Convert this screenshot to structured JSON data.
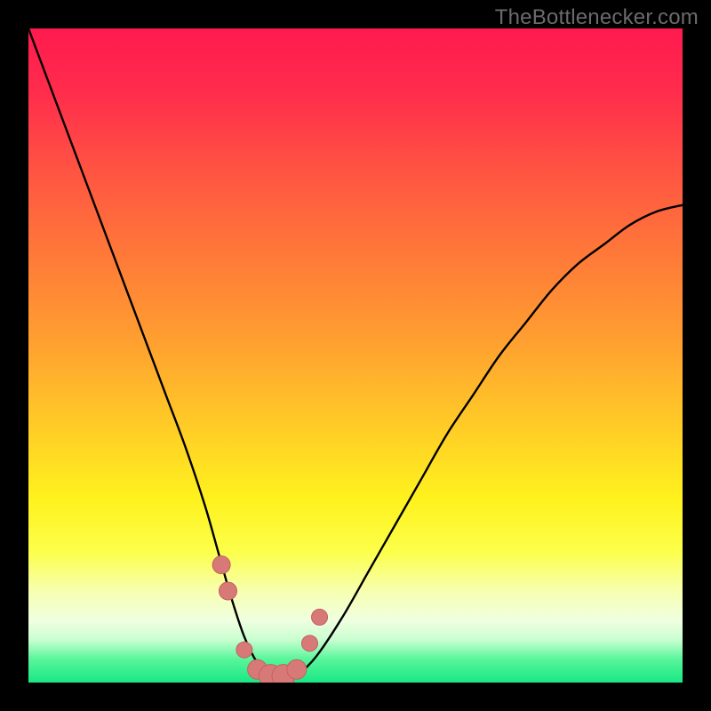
{
  "watermark": {
    "text": "TheBottlenecker.com"
  },
  "colors": {
    "background": "#000000",
    "curve": "#000000",
    "markers_fill": "#d77a77",
    "markers_stroke": "#c46060",
    "gradient_stops": [
      {
        "offset": 0.0,
        "color": "#ff1a4e"
      },
      {
        "offset": 0.1,
        "color": "#ff2d4c"
      },
      {
        "offset": 0.22,
        "color": "#ff5542"
      },
      {
        "offset": 0.35,
        "color": "#ff7a38"
      },
      {
        "offset": 0.48,
        "color": "#ffa030"
      },
      {
        "offset": 0.6,
        "color": "#ffc927"
      },
      {
        "offset": 0.72,
        "color": "#fff21e"
      },
      {
        "offset": 0.8,
        "color": "#fcff4a"
      },
      {
        "offset": 0.86,
        "color": "#f7ffb0"
      },
      {
        "offset": 0.905,
        "color": "#f0ffe0"
      },
      {
        "offset": 0.935,
        "color": "#c8ffd0"
      },
      {
        "offset": 0.965,
        "color": "#57f59a"
      },
      {
        "offset": 1.0,
        "color": "#18e884"
      }
    ]
  },
  "chart_data": {
    "type": "line",
    "title": "",
    "xlabel": "",
    "ylabel": "",
    "xlim": [
      0,
      100
    ],
    "ylim": [
      0,
      100
    ],
    "grid": false,
    "legend": false,
    "series": [
      {
        "name": "bottleneck-curve",
        "x": [
          0,
          3,
          6,
          9,
          12,
          15,
          18,
          21,
          24,
          27,
          29,
          31,
          33,
          35,
          37,
          39,
          41,
          44,
          48,
          52,
          56,
          60,
          64,
          68,
          72,
          76,
          80,
          84,
          88,
          92,
          96,
          100
        ],
        "values": [
          100,
          92,
          84,
          76,
          68,
          60,
          52,
          44,
          36,
          27,
          20,
          13,
          7,
          3,
          1,
          0,
          1,
          4,
          10,
          17,
          24,
          31,
          38,
          44,
          50,
          55,
          60,
          64,
          67,
          70,
          72,
          73
        ]
      }
    ],
    "markers": {
      "name": "highlight-dots",
      "x": [
        29.5,
        30.5,
        33.0,
        35.0,
        37.0,
        39.0,
        41.0,
        43.0,
        44.5
      ],
      "values": [
        18.0,
        14.0,
        5.0,
        2.0,
        1.0,
        1.0,
        2.0,
        6.0,
        10.0
      ],
      "radius": [
        10,
        10,
        9,
        11,
        13,
        13,
        11,
        9,
        9
      ]
    }
  }
}
